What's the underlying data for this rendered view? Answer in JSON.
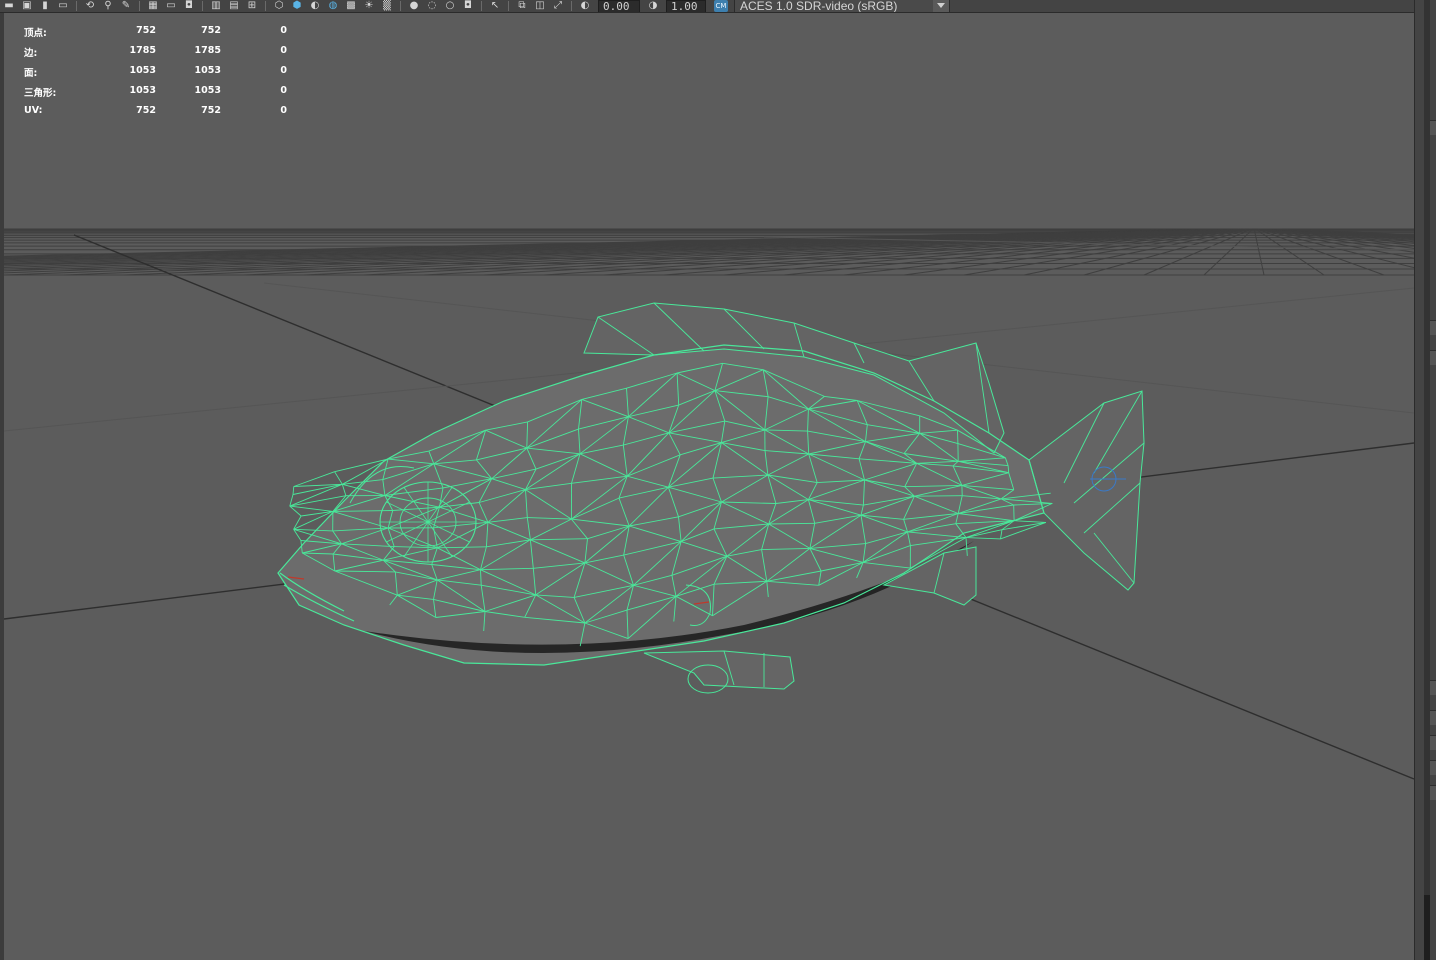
{
  "toolbar": {
    "icons": [
      "camera-icon",
      "camera-attr-icon",
      "bookmark-icon",
      "image-plane-icon",
      "isolate-icon",
      "xray-icon",
      "grease-pencil-icon",
      "grid-icon",
      "film-gate-icon",
      "resolution-gate-icon",
      "gate-mask-icon",
      "field-chart-icon",
      "safe-action-icon",
      "wireframe-icon",
      "smooth-shade-icon",
      "default-material-icon",
      "wireframe-on-shaded-icon",
      "textured-icon",
      "use-lights-icon",
      "shadows-icon",
      "screen-space-ao-icon",
      "motion-blur-icon",
      "antialiasing-icon",
      "depth-of-field-icon",
      "select-camera-icon",
      "isolate-select-icon",
      "xray-joints-icon",
      "xray-active-icon",
      "exposure-icon",
      "gamma-icon"
    ],
    "exposure_value": "0.00",
    "gamma_value": "1.00",
    "color_mgmt_badge": "CM",
    "colorspace_label": "ACES 1.0 SDR-video (sRGB)"
  },
  "hud": {
    "rows": [
      {
        "label": "顶点:",
        "v1": "752",
        "v2": "752",
        "v3": "0"
      },
      {
        "label": "边:",
        "v1": "1785",
        "v2": "1785",
        "v3": "0"
      },
      {
        "label": "面:",
        "v1": "1053",
        "v2": "1053",
        "v3": "0"
      },
      {
        "label": "三角形:",
        "v1": "1053",
        "v2": "1053",
        "v3": "0"
      },
      {
        "label": "UV:",
        "v1": "752",
        "v2": "752",
        "v3": "0"
      }
    ]
  },
  "colors": {
    "wireframe": "#49e89a",
    "grid": "#3f3f3f",
    "grid_axis": "#2e2e2e",
    "body": "#6c6c6c",
    "belly_shadow": "#1a1a1a"
  }
}
